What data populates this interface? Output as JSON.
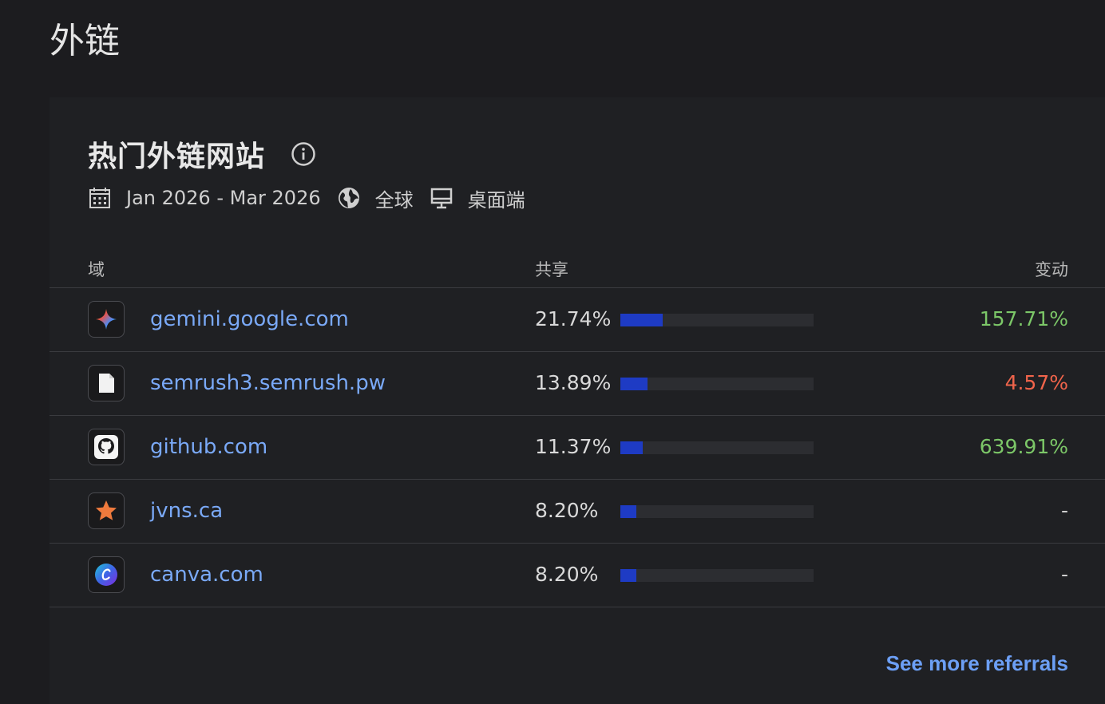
{
  "page": {
    "title": "外链"
  },
  "card": {
    "title": "热门外链网站",
    "info_icon": "info-icon",
    "meta": {
      "date_range": "Jan 2026 - Mar 2026",
      "region": "全球",
      "device": "桌面端"
    },
    "columns": {
      "domain": "域",
      "share": "共享",
      "change": "变动"
    },
    "rows": [
      {
        "domain": "gemini.google.com",
        "share": "21.74%",
        "share_value": 21.74,
        "change": "157.71%",
        "change_color": "#7cc768",
        "icon": "gemini-icon"
      },
      {
        "domain": "semrush3.semrush.pw",
        "share": "13.89%",
        "share_value": 13.89,
        "change": "4.57%",
        "change_color": "#f0644b",
        "icon": "blank-page-icon"
      },
      {
        "domain": "github.com",
        "share": "11.37%",
        "share_value": 11.37,
        "change": "639.91%",
        "change_color": "#7cc768",
        "icon": "github-icon"
      },
      {
        "domain": "jvns.ca",
        "share": "8.20%",
        "share_value": 8.2,
        "change": "-",
        "change_color": "#cfcfcf",
        "icon": "star-icon"
      },
      {
        "domain": "canva.com",
        "share": "8.20%",
        "share_value": 8.2,
        "change": "-",
        "change_color": "#cfcfcf",
        "icon": "canva-icon"
      }
    ],
    "see_more": "See more referrals"
  },
  "colors": {
    "bar_fill": "#1e3bc4",
    "bar_track": "#2c2d31",
    "link": "#7aa9f7",
    "positive": "#7cc768",
    "negative": "#f0644b"
  }
}
